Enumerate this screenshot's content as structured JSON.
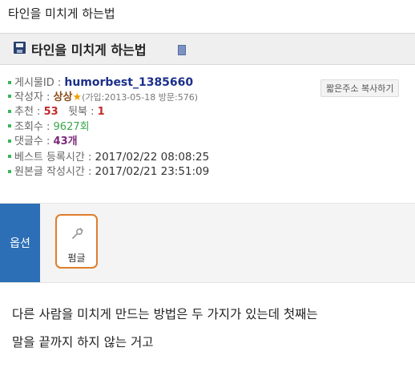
{
  "page": {
    "title": "타인을 미치게 하는법"
  },
  "post": {
    "title": "타인을 미치게 하는법"
  },
  "meta": {
    "post_id_label": "게시물ID : ",
    "post_id": "humorbest_1385660",
    "copy_link": "짧은주소 복사하기",
    "author_label": "작성자 : ",
    "author": "상상",
    "author_star": "★",
    "author_info": "(가입:2013-05-18 방문:576)",
    "rec_label": "추천 : ",
    "rec": "53",
    "down_label": "뒷북 : ",
    "down": "1",
    "views_label": "조회수 : ",
    "views": "9627회",
    "comments_label": "댓글수 : ",
    "comments": "43개",
    "best_label": "베스트 등록시간 : ",
    "best_time": "2017/02/22 08:08:25",
    "orig_label": "원본글 작성시간 : ",
    "orig_time": "2017/02/21 23:51:09"
  },
  "options": {
    "label": "옵션",
    "pin_label": "펌글"
  },
  "body": {
    "line1": "다른 사람을 미치게 만드는 방법은 두 가지가 있는데 첫째는",
    "line2": "말을 끝까지 하지 않는 거고"
  },
  "colors": {
    "accent_blue": "#2c6fb7",
    "pin_border": "#e07d2a",
    "bullet_green": "#3bb55b",
    "rec_red": "#c22a2a"
  },
  "icons": {
    "post_icon": "floppy-disk-icon",
    "pin_icon": "pin-icon",
    "attach_icon": "document-icon"
  }
}
